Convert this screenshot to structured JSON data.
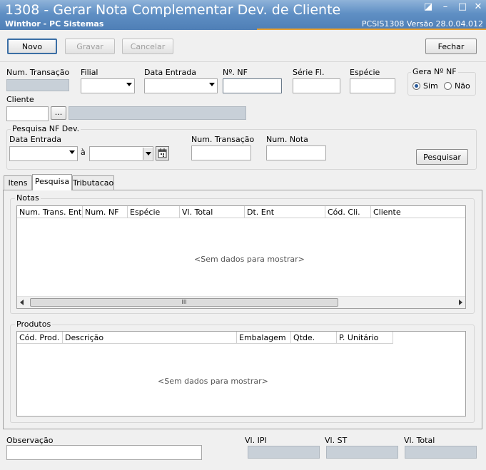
{
  "window": {
    "title": "1308 - Gerar Nota Complementar Dev. de Cliente",
    "subtitle": "Winthor - PC Sistemas",
    "version": "PCSIS1308  Versão  28.0.04.012",
    "controls": [
      "◪",
      "–",
      "□",
      "✕"
    ]
  },
  "toolbar": {
    "novo": "Novo",
    "gravar": "Gravar",
    "cancelar": "Cancelar",
    "fechar": "Fechar"
  },
  "header": {
    "num_transacao_label": "Num. Transação",
    "filial_label": "Filial",
    "data_entrada_label": "Data Entrada",
    "nf_label": "Nº. NF",
    "serie_label": "Série Fl.",
    "especie_label": "Espécie",
    "gera_nf_label": "Gera Nº NF",
    "sim_label": "Sim",
    "nao_label": "Não",
    "gera_nf_selected": "Sim",
    "cliente_label": "Cliente",
    "cliente_btn": "..."
  },
  "pesquisa": {
    "group_title": "Pesquisa NF Dev.",
    "data_entrada_label": "Data Entrada",
    "a_label": "à",
    "num_transacao_label": "Num. Transação",
    "num_nota_label": "Num. Nota",
    "pesquisar_btn": "Pesquisar"
  },
  "tabs": [
    {
      "label": "Itens",
      "active": false
    },
    {
      "label": "Pesquisa",
      "active": true
    },
    {
      "label": "Tributacao",
      "active": false
    }
  ],
  "notas": {
    "title": "Notas",
    "columns": [
      "Num. Trans. Ent.",
      "Num. NF",
      "Espécie",
      "Vl. Total",
      "Dt. Ent",
      "Cód. Cli.",
      "Cliente"
    ],
    "empty": "<Sem dados para mostrar>",
    "scroll_label": "III"
  },
  "produtos": {
    "title": "Produtos",
    "columns": [
      "Cód. Prod.",
      "Descrição",
      "Embalagem",
      "Qtde.",
      "P. Unitário"
    ],
    "empty": "<Sem dados para mostrar>"
  },
  "footer": {
    "observacao_label": "Observação",
    "vl_ipi_label": "Vl. IPI",
    "vl_st_label": "Vl. ST",
    "vl_total_label": "Vl. Total"
  },
  "colors": {
    "titlebar": "#5f8fc4",
    "accent_line": "#e8a030",
    "readonly_field": "#c8d0d8"
  },
  "icons": {
    "calendar": "calendar-icon",
    "dropdown": "chevron-down-icon"
  }
}
